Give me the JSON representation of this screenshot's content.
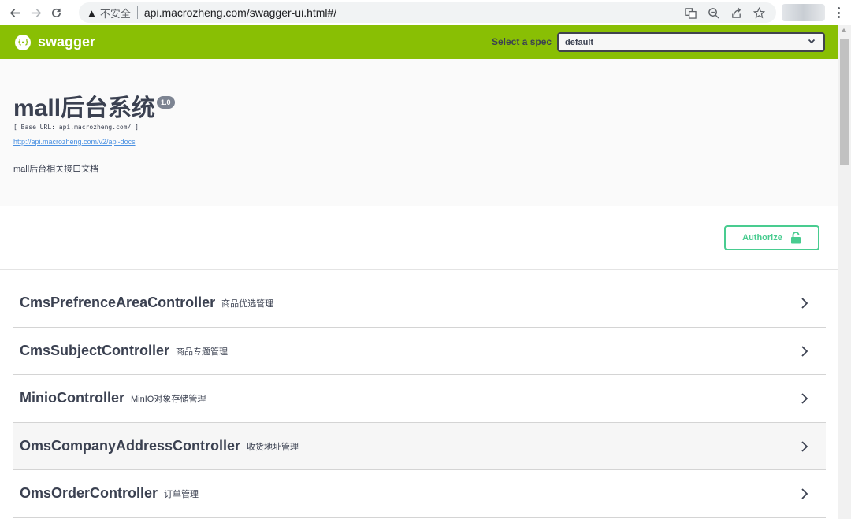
{
  "browser": {
    "insecure_label": "不安全",
    "url": "api.macrozheng.com/swagger-ui.html#/"
  },
  "topbar": {
    "logo_symbol": "{-}",
    "logo_text": "swagger",
    "spec_label": "Select a spec",
    "spec_value": "default"
  },
  "info": {
    "title": "mall后台系统",
    "version": "1.0",
    "base_url": "[ Base URL: api.macrozheng.com/ ]",
    "docs_link": "http://api.macrozheng.com/v2/api-docs",
    "description": "mall后台相关接口文档"
  },
  "auth": {
    "label": "Authorize"
  },
  "tags": [
    {
      "name": "CmsPrefrenceAreaController",
      "description": "商品优选管理"
    },
    {
      "name": "CmsSubjectController",
      "description": "商品专题管理"
    },
    {
      "name": "MinioController",
      "description": "MinIO对象存储管理"
    },
    {
      "name": "OmsCompanyAddressController",
      "description": "收货地址管理"
    },
    {
      "name": "OmsOrderController",
      "description": "订单管理"
    }
  ],
  "colors": {
    "topbar": "#89bf04",
    "authorize": "#49cc90",
    "link": "#4990e2"
  }
}
